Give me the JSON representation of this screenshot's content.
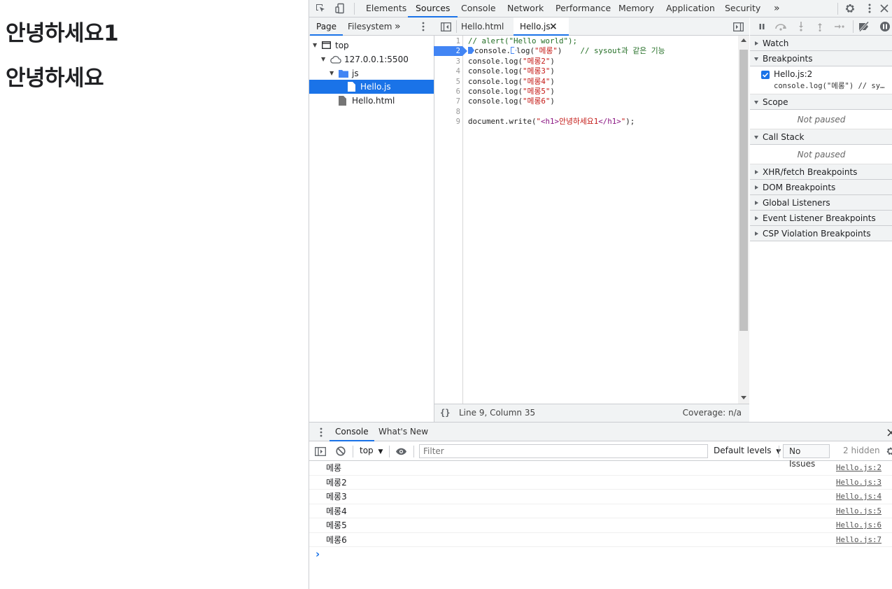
{
  "page": {
    "h1_a": "안녕하세요1",
    "h1_b": "안녕하세요"
  },
  "devtools": {
    "main_tabs": [
      "Elements",
      "Sources",
      "Console",
      "Network",
      "Performance",
      "Memory",
      "Application",
      "Security"
    ],
    "more": "»",
    "nav_tabs": [
      "Page",
      "Filesystem"
    ],
    "tree": {
      "top": "top",
      "host": "127.0.0.1:5500",
      "folder": "js",
      "file_sel": "Hello.js",
      "file2": "Hello.html"
    },
    "file_tabs": [
      "Hello.html",
      "Hello.js"
    ],
    "close_glyph": "×",
    "lines": [
      "1",
      "2",
      "3",
      "4",
      "5",
      "6",
      "7",
      "8",
      "9"
    ],
    "code": {
      "l1": "// alert(\"Hello world\");",
      "l2a": "console.",
      "l2b": "log(",
      "l2c": "\"메롱\"",
      "l2d": ")",
      "l2e": "// sysout과 같은 기능",
      "l3": "\"메롱2\"",
      "l4": "\"메롱3\"",
      "l5": "\"메롱4\"",
      "l6": "\"메롱5\"",
      "l7": "\"메롱6\"",
      "log_open": "console.log(",
      "close": ")",
      "l9a": "document.write(",
      "l9q": "\"",
      "l9t1": "<h1>",
      "l9s": "안녕하세요1",
      "l9t2": "</h1>",
      "l9end": ");"
    },
    "status": {
      "braces": "{}",
      "cursor": "Line 9, Column 35",
      "coverage": "Coverage: n/a"
    },
    "debug": {
      "watch": "Watch",
      "breakpoints": "Breakpoints",
      "bp_file": "Hello.js:2",
      "bp_code": "console.log(\"메롱\") // sy…",
      "scope": "Scope",
      "not_paused": "Not paused",
      "call_stack": "Call Stack",
      "xhr": "XHR/fetch Breakpoints",
      "dom": "DOM Breakpoints",
      "global": "Global Listeners",
      "event": "Event Listener Breakpoints",
      "csp": "CSP Violation Breakpoints"
    },
    "drawer": {
      "tabs": [
        "Console",
        "What's New"
      ],
      "context": "top",
      "filter_placeholder": "Filter",
      "levels": "Default levels",
      "issues": "No Issues",
      "hidden": "2 hidden"
    },
    "console_rows": [
      {
        "msg": "메롱",
        "src": "Hello.js:2"
      },
      {
        "msg": "메롱2",
        "src": "Hello.js:3"
      },
      {
        "msg": "메롱3",
        "src": "Hello.js:4"
      },
      {
        "msg": "메롱4",
        "src": "Hello.js:5"
      },
      {
        "msg": "메롱5",
        "src": "Hello.js:6"
      },
      {
        "msg": "메롱6",
        "src": "Hello.js:7"
      }
    ],
    "prompt": "›"
  },
  "colors": {
    "accent": "#1a73e8",
    "comment": "#236e25",
    "string": "#c41a16",
    "tag": "#881280"
  }
}
